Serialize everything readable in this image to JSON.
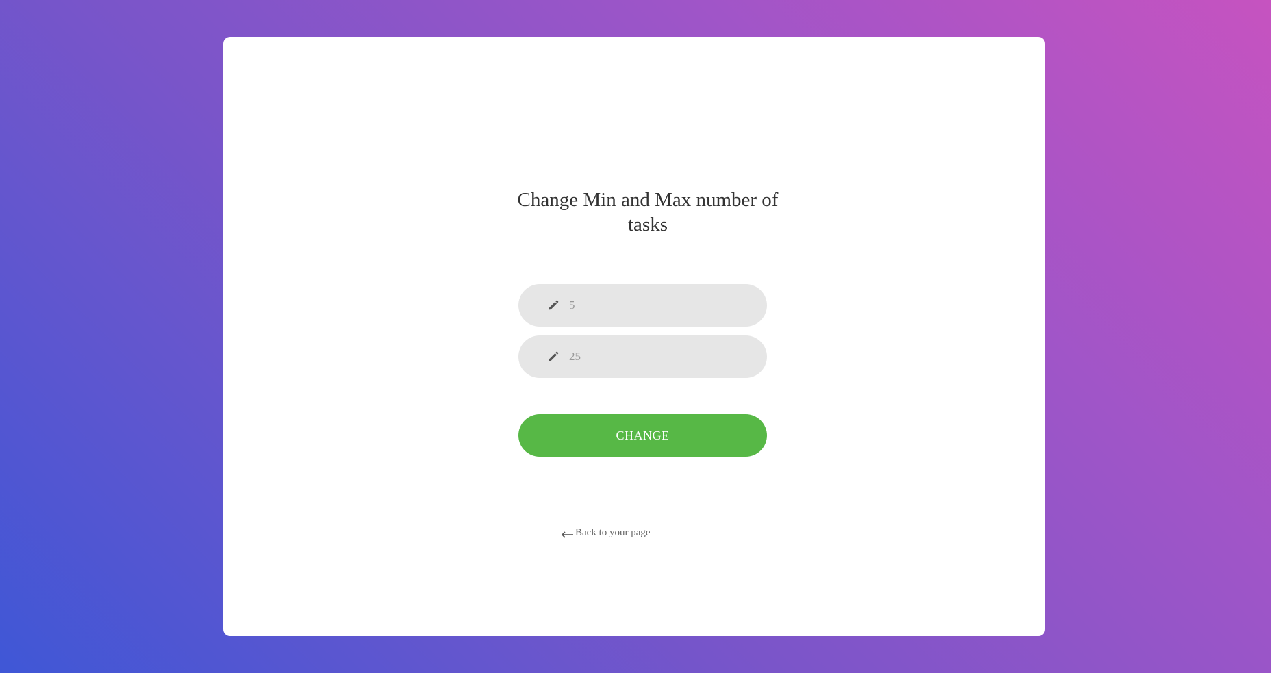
{
  "form": {
    "title": "Change Min and Max number of tasks",
    "min_field": {
      "value": "",
      "placeholder": "5",
      "icon": "pencil-icon"
    },
    "max_field": {
      "value": "",
      "placeholder": "25",
      "icon": "pencil-icon"
    },
    "submit_label": "CHANGE",
    "back_link": {
      "label": "Back to your page",
      "icon": "arrow-left-icon"
    }
  },
  "colors": {
    "background_start": "#3f57d6",
    "background_end": "#c653c0",
    "card": "#ffffff",
    "field_bg": "#e6e6e6",
    "button": "#57b846",
    "title_text": "#333333"
  }
}
